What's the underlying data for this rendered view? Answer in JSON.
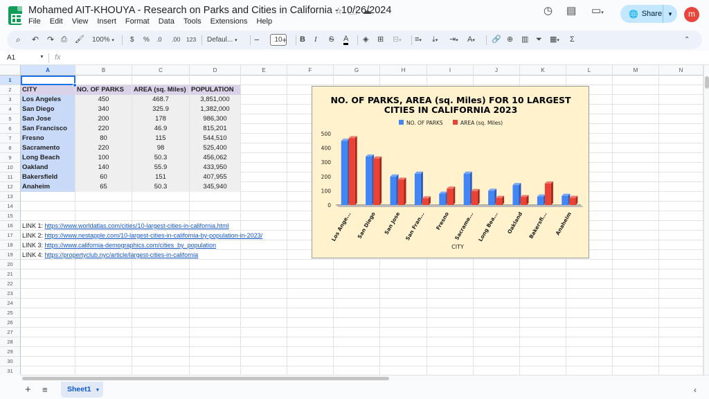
{
  "header": {
    "title": "Mohamed AIT-KHOUYA - Research on Parks and Cities in California - 10/26/2024",
    "menu": [
      "File",
      "Edit",
      "View",
      "Insert",
      "Format",
      "Data",
      "Tools",
      "Extensions",
      "Help"
    ],
    "share_label": "Share",
    "avatar_letter": "m",
    "icons": [
      "star-icon",
      "move-folder-icon",
      "cloud-status-icon",
      "history-icon",
      "comment-icon",
      "meet-icon",
      "globe-icon"
    ]
  },
  "toolbar": {
    "zoom": "100%",
    "currency": "$",
    "percent": "%",
    "dec_decrease": ".0",
    "dec_increase": ".00",
    "number_format": "123",
    "font": "Defaul...",
    "font_size": "10",
    "bold": "B",
    "italic": "I",
    "strike": "S",
    "text_color": "A",
    "function": "Σ"
  },
  "formula_bar": {
    "name_box": "A1",
    "fx": "fx",
    "value": ""
  },
  "grid": {
    "columns": [
      "A",
      "B",
      "C",
      "D",
      "E",
      "F",
      "G",
      "H",
      "I",
      "J",
      "K",
      "L",
      "M",
      "N"
    ],
    "rows": [
      "1",
      "2",
      "3",
      "4",
      "5",
      "6",
      "7",
      "8",
      "9",
      "10",
      "11",
      "12",
      "13",
      "14",
      "15",
      "16",
      "17",
      "18",
      "19",
      "20",
      "21",
      "22",
      "23",
      "24",
      "25",
      "26",
      "27",
      "28",
      "29",
      "30",
      "31"
    ],
    "selected_cell": "A1"
  },
  "table": {
    "headers": [
      "CITY",
      "NO. OF PARKS",
      "AREA (sq. Miles)",
      "POPULATION"
    ],
    "rows": [
      [
        "Los Angeles",
        "450",
        "468.7",
        "3,851,000"
      ],
      [
        "San Diego",
        "340",
        "325.9",
        "1,382,000"
      ],
      [
        "San Jose",
        "200",
        "178",
        "986,300"
      ],
      [
        "San Francisco",
        "220",
        "46.9",
        "815,201"
      ],
      [
        "Fresno",
        "80",
        "115",
        "544,510"
      ],
      [
        "Sacramento",
        "220",
        "98",
        "525,400"
      ],
      [
        "Long Beach",
        "100",
        "50.3",
        "456,062"
      ],
      [
        "Oakland",
        "140",
        "55.9",
        "433,950"
      ],
      [
        "Bakersfield",
        "60",
        "151",
        "407,955"
      ],
      [
        "Anaheim",
        "65",
        "50.3",
        "345,940"
      ]
    ]
  },
  "links": [
    {
      "label": "LINK 1: ",
      "url": "https://www.worldatlas.com/cities/10-largest-cities-in-california.html"
    },
    {
      "label": "LINK 2: ",
      "url": "https://www.nestapple.com/10-largest-cities-in-california-by-population-in-2023/"
    },
    {
      "label": "LINK 3: ",
      "url": "https://www.california-demographics.com/cities_by_population"
    },
    {
      "label": "LINK 4: ",
      "url": "https://propertyclub.nyc/article/largest-cities-in-california"
    }
  ],
  "chart_data": {
    "type": "bar",
    "title": "NO. OF PARKS, AREA (sq. Miles) FOR 10 LARGEST CITIES IN CALIFORNIA 2023",
    "title_lines": [
      "NO. OF PARKS, AREA (sq. Miles) FOR 10 LARGEST",
      "CITIES IN CALIFORNIA 2023"
    ],
    "xlabel": "CITY",
    "ylabel": "",
    "categories": [
      "Los Angeles",
      "San Diego",
      "San Jose",
      "San Francisco",
      "Fresno",
      "Sacramento",
      "Long Beach",
      "Oakland",
      "Bakersfield",
      "Anaheim"
    ],
    "tick_labels": [
      "Los Ange...",
      "San Diego",
      "San Jose",
      "San Fran...",
      "Fresno",
      "Sacrame...",
      "Long Bea...",
      "Oakland",
      "Bakersfi...",
      "Anaheim"
    ],
    "series": [
      {
        "name": "NO. OF PARKS",
        "values": [
          450,
          340,
          200,
          220,
          80,
          220,
          100,
          140,
          60,
          65
        ],
        "color": "#4285f4"
      },
      {
        "name": "AREA (sq. Miles)",
        "values": [
          468.7,
          325.9,
          178,
          46.9,
          115,
          98,
          50.3,
          55.9,
          151,
          50.3
        ],
        "color": "#ea4335"
      }
    ],
    "ylim": [
      0,
      500
    ],
    "yticks": [
      "0",
      "100",
      "200",
      "300",
      "400",
      "500"
    ],
    "legend": "top",
    "grid": false,
    "background": "#fff2cc"
  },
  "sheets": {
    "active": "Sheet1"
  }
}
